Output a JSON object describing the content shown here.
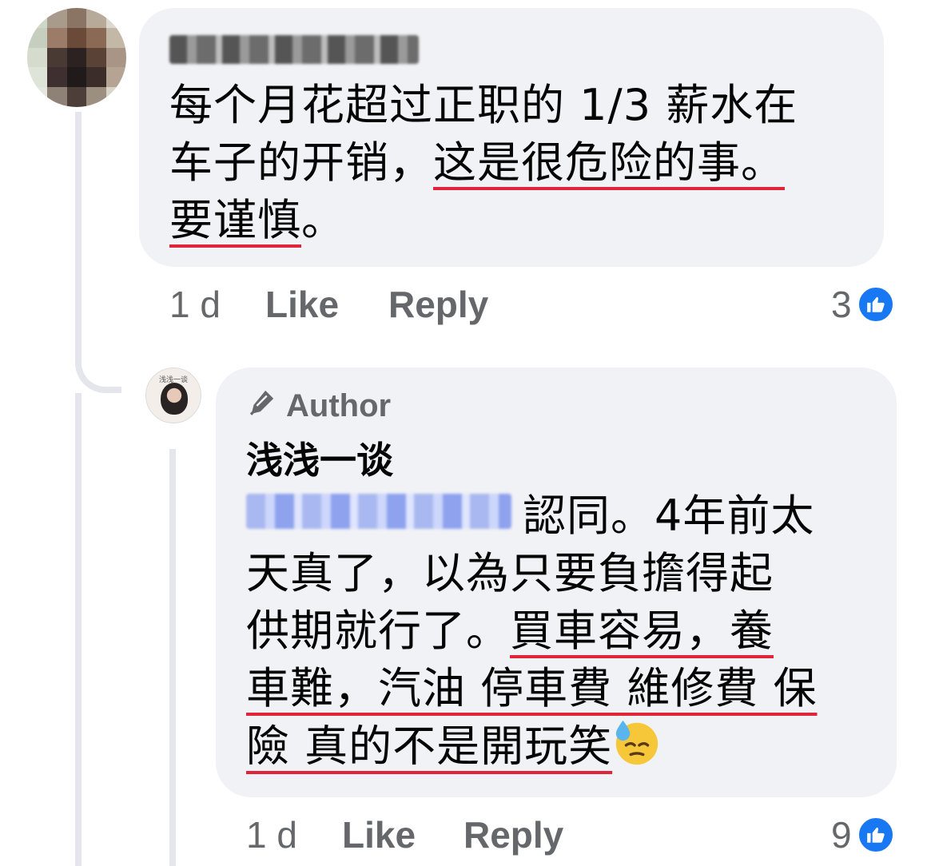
{
  "comment1": {
    "text_line1": "每个月花超过正职的 1/3 薪水在",
    "text_line2_a": "车子的开销，",
    "text_line2_b": "这是很危险的事。",
    "text_line3_a": "要谨慎",
    "text_line3_b": "。",
    "time": "1 d",
    "like_label": "Like",
    "reply_label": "Reply",
    "reaction_count": "3"
  },
  "reply": {
    "badge_label": "Author",
    "author": "浅浅一谈",
    "text_after_mention": "認同。4年前太",
    "line2": "天真了，以為只要負擔得起",
    "line3_a": "供期就行了。",
    "line3_b": "買車容易，養",
    "line4": "車難，汽油 停車費 維修費 保",
    "line5": "險 真的不是開玩笑",
    "emoji": "downcast-face-with-sweat",
    "time": "1 d",
    "like_label": "Like",
    "reply_label": "Reply",
    "reaction_count": "9"
  },
  "colors": {
    "bubble": "#f0f2f5",
    "meta_text": "#65676b",
    "like_blue": "#1877f2",
    "underline_red": "#e0243a"
  }
}
